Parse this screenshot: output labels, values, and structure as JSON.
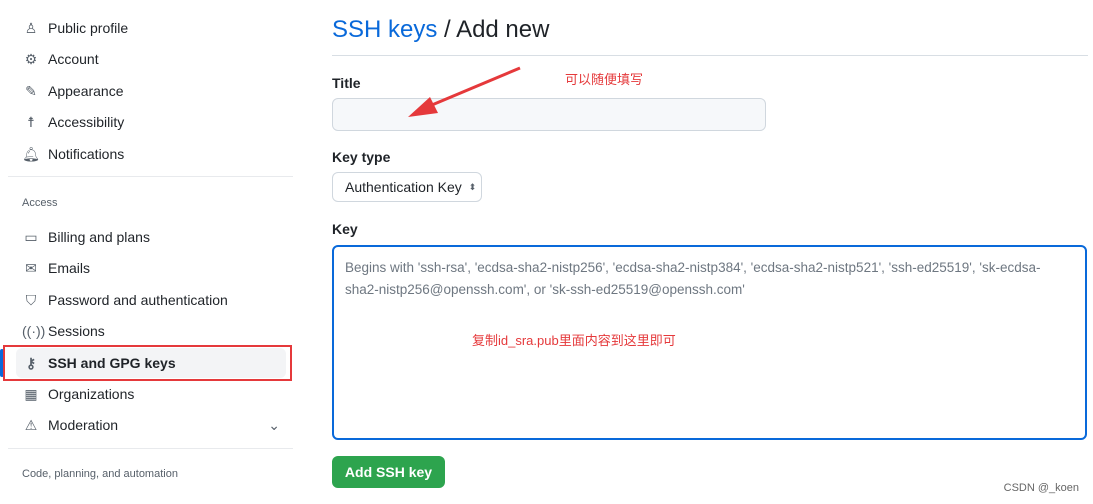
{
  "sidebar": {
    "items": [
      {
        "label": "Public profile",
        "icon": "person-icon"
      },
      {
        "label": "Account",
        "icon": "gear-icon"
      },
      {
        "label": "Appearance",
        "icon": "paintbrush-icon"
      },
      {
        "label": "Accessibility",
        "icon": "accessibility-icon"
      },
      {
        "label": "Notifications",
        "icon": "bell-icon"
      }
    ],
    "access_heading": "Access",
    "access_items": [
      {
        "label": "Billing and plans",
        "icon": "credit-card-icon"
      },
      {
        "label": "Emails",
        "icon": "mail-icon"
      },
      {
        "label": "Password and authentication",
        "icon": "shield-icon"
      },
      {
        "label": "Sessions",
        "icon": "broadcast-icon"
      },
      {
        "label": "SSH and GPG keys",
        "icon": "key-icon",
        "active": true
      },
      {
        "label": "Organizations",
        "icon": "organization-icon"
      },
      {
        "label": "Moderation",
        "icon": "report-icon"
      }
    ],
    "code_heading": "Code, planning, and automation"
  },
  "main": {
    "breadcrumb_link": "SSH keys",
    "breadcrumb_sep": " / ",
    "title": "Add new",
    "title_label": "Title",
    "title_value": "",
    "key_type_label": "Key type",
    "key_type_value": "Authentication Key",
    "key_label": "Key",
    "key_placeholder": "Begins with 'ssh-rsa', 'ecdsa-sha2-nistp256', 'ecdsa-sha2-nistp384', 'ecdsa-sha2-nistp521', 'ssh-ed25519', 'sk-ecdsa-sha2-nistp256@openssh.com', or 'sk-ssh-ed25519@openssh.com'",
    "submit": "Add SSH key"
  },
  "annotations": {
    "title_note": "可以随便填写",
    "key_note": "复制id_sra.pub里面内容到这里即可"
  },
  "watermark": "CSDN @_koen"
}
